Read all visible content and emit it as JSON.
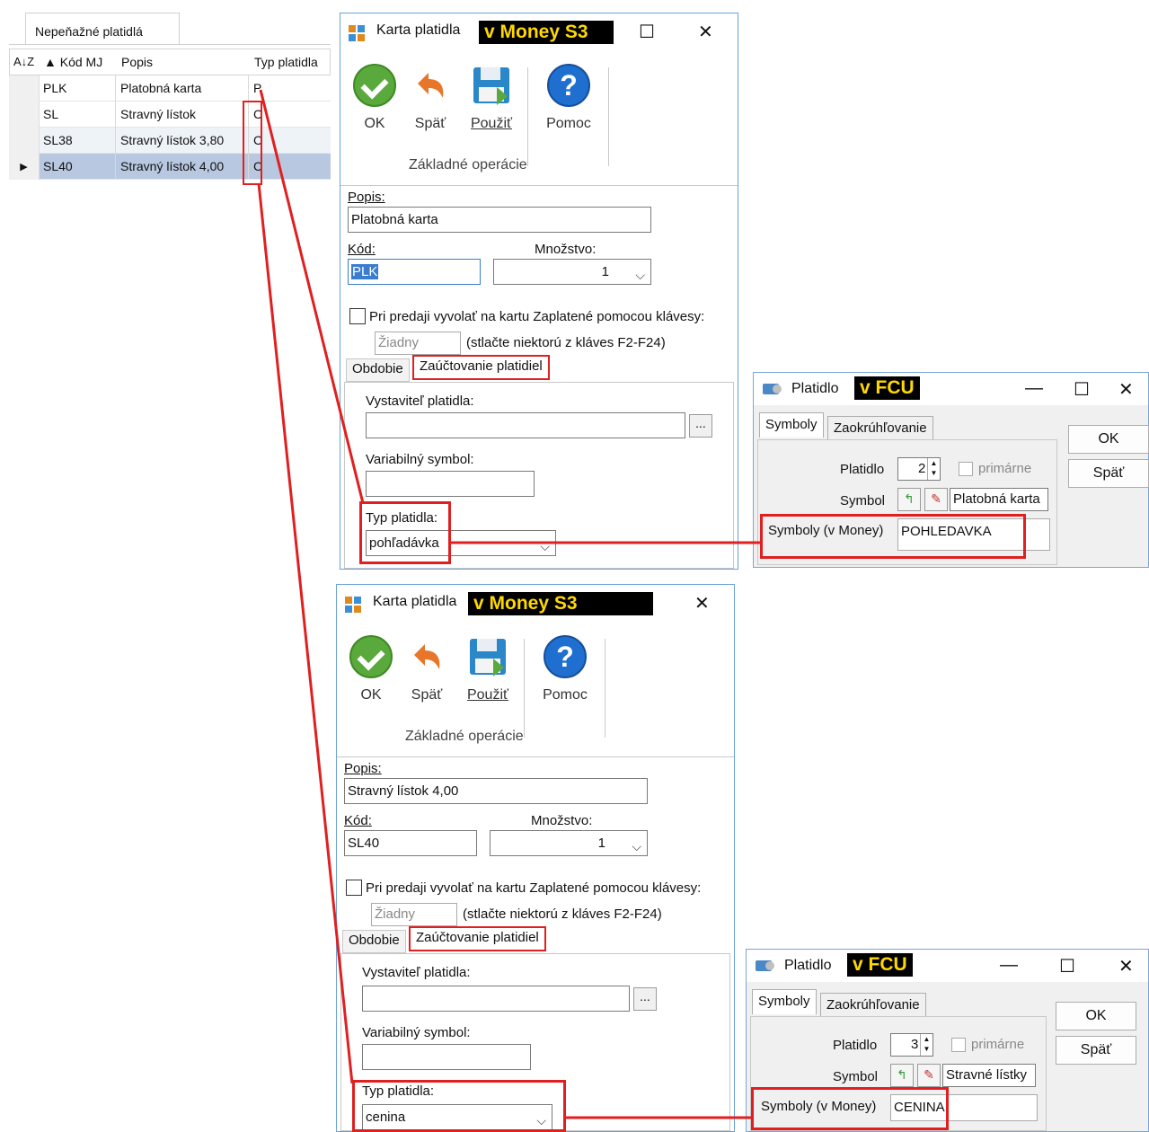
{
  "grid": {
    "tab": "Nepeňažné platidlá",
    "sort_icon": "sort-az-icon",
    "columns": [
      "▲ Kód MJ",
      "Popis",
      "Typ platidla"
    ],
    "rows": [
      {
        "kod": "PLK",
        "popis": "Platobná karta",
        "typ": "P"
      },
      {
        "kod": "SL",
        "popis": "Stravný lístok",
        "typ": "C"
      },
      {
        "kod": "SL38",
        "popis": "Stravný lístok 3,80",
        "typ": "C"
      },
      {
        "kod": "SL40",
        "popis": "Stravný lístok 4,00",
        "typ": "C"
      }
    ],
    "current_row_marker": "▶"
  },
  "karta1": {
    "title": "Karta platidla",
    "tag": "v Money S3",
    "maximize": "☐",
    "close": "✕",
    "toolbar": {
      "ok": "OK",
      "spat": "Späť",
      "pouzit": "Použiť",
      "pomoc": "Pomoc",
      "group": "Základné operácie"
    },
    "popis_label": "Popis:",
    "popis_value": "Platobná karta",
    "kod_label": "Kód:",
    "kod_value": "PLK",
    "mnozstvo_label": "Množstvo:",
    "mnozstvo_value": "1",
    "checkbox_label": "Pri predaji vyvolať na kartu Zaplatené pomocou klávesy:",
    "key_value": "Žiadny",
    "key_hint": "(stlačte niektorú z kláves F2-F24)",
    "tab_obdobie": "Obdobie",
    "tab_zauctovanie": "Zaúčtovanie platidiel",
    "vystavitel_label": "Vystaviteľ platidla:",
    "dots": "...",
    "variabilny_label": "Variabilný symbol:",
    "typ_label": "Typ platidla:",
    "typ_value": "pohľadávka"
  },
  "plat1": {
    "title": "Platidlo",
    "tag": "v FCU",
    "minimize": "—",
    "maximize": "☐",
    "close": "✕",
    "tab_symboly": "Symboly",
    "tab_zaokruhlovanie": "Zaokrúhľovanie",
    "ok": "OK",
    "spat": "Späť",
    "platidlo_label": "Platidlo",
    "platidlo_value": "2",
    "primarne": "primárne",
    "symbol_label": "Symbol",
    "symbol_value": "Platobná karta",
    "symboly_money_label": "Symboly (v Money)",
    "symboly_money_value": "POHLEDAVKA"
  },
  "karta2": {
    "title": "Karta platidla",
    "tag": "v Money S3",
    "close": "✕",
    "toolbar": {
      "ok": "OK",
      "spat": "Späť",
      "pouzit": "Použiť",
      "pomoc": "Pomoc",
      "group": "Základné operácie"
    },
    "popis_label": "Popis:",
    "popis_value": "Stravný lístok 4,00",
    "kod_label": "Kód:",
    "kod_value": "SL40",
    "mnozstvo_label": "Množstvo:",
    "mnozstvo_value": "1",
    "checkbox_label": "Pri predaji vyvolať na kartu Zaplatené pomocou klávesy:",
    "key_value": "Žiadny",
    "key_hint": "(stlačte niektorú z kláves F2-F24)",
    "tab_obdobie": "Obdobie",
    "tab_zauctovanie": "Zaúčtovanie platidiel",
    "vystavitel_label": "Vystaviteľ platidla:",
    "dots": "...",
    "variabilny_label": "Variabilný symbol:",
    "typ_label": "Typ platidla:",
    "typ_value": "cenina"
  },
  "plat2": {
    "title": "Platidlo",
    "tag": "v FCU",
    "minimize": "—",
    "maximize": "☐",
    "close": "✕",
    "tab_symboly": "Symboly",
    "tab_zaokruhlovanie": "Zaokrúhľovanie",
    "ok": "OK",
    "spat": "Späť",
    "platidlo_label": "Platidlo",
    "platidlo_value": "3",
    "primarne": "primárne",
    "symbol_label": "Symbol",
    "symbol_value": "Stravné lístky",
    "symboly_money_label": "Symboly (v Money)",
    "symboly_money_value": "CENINA"
  },
  "colors": {
    "highlight": "#e02020",
    "tag_bg": "#000000",
    "tag_fg": "#ffd800",
    "selected_row": "#b8c8e0"
  }
}
